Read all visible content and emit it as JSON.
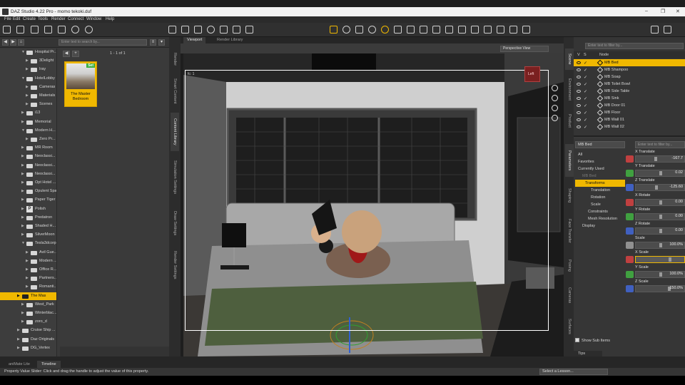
{
  "window": {
    "title": "DAZ Studio 4.22 Pro - momo tekoki.duf",
    "controls": [
      "–",
      "❐",
      "✕"
    ]
  },
  "menu": [
    "File",
    "Edit",
    "Create",
    "Tools",
    "Render",
    "Connect",
    "Window",
    "Help"
  ],
  "toolbar": {
    "icons": [
      "move-icon",
      "rotate-icon",
      "scale-icon",
      "universal-icon",
      "node-select-icon",
      "joint-editor-icon",
      "camera-icon",
      "light-icon",
      "render-icon"
    ]
  },
  "content_library": {
    "search_placeholder": "Enter text to search by...",
    "page": "1 - 1 of 1",
    "nav_prev": "◀",
    "nav_next": "+",
    "tree": [
      {
        "label": "Hospital Pr...",
        "depth": 2,
        "expanded": true
      },
      {
        "label": "3Delight",
        "depth": 3
      },
      {
        "label": "Iray",
        "depth": 3
      },
      {
        "label": "HotelLobby",
        "depth": 2,
        "expanded": true
      },
      {
        "label": "Cameras",
        "depth": 3
      },
      {
        "label": "Materials",
        "depth": 3
      },
      {
        "label": "Scenes",
        "depth": 3
      },
      {
        "label": "i13",
        "depth": 2
      },
      {
        "label": "Memorial",
        "depth": 2
      },
      {
        "label": "Modern H...",
        "depth": 2,
        "expanded": true
      },
      {
        "label": "Zero Pr...",
        "depth": 3
      },
      {
        "label": "MR Room",
        "depth": 2
      },
      {
        "label": "Neoclassi...",
        "depth": 2
      },
      {
        "label": "Neoclassi...",
        "depth": 2
      },
      {
        "label": "Neoclassi...",
        "depth": 2
      },
      {
        "label": "Opt Hotel ...",
        "depth": 2
      },
      {
        "label": "Opulent Spa",
        "depth": 2
      },
      {
        "label": "Paper Tiger",
        "depth": 2
      },
      {
        "label": "Polish",
        "depth": 2,
        "product": true
      },
      {
        "label": "Predatron",
        "depth": 2
      },
      {
        "label": "Shaded H...",
        "depth": 2
      },
      {
        "label": "SilverMoon",
        "depth": 2
      },
      {
        "label": "Tesla3dcorp",
        "depth": 2,
        "expanded": true
      },
      {
        "label": "Avil Gue...",
        "depth": 3
      },
      {
        "label": "Modern ...",
        "depth": 3
      },
      {
        "label": "Office R...",
        "depth": 3
      },
      {
        "label": "Partners...",
        "depth": 3
      },
      {
        "label": "Romanti...",
        "depth": 3
      },
      {
        "label": "The Mas",
        "depth": 1,
        "selected": true
      },
      {
        "label": "West_Park",
        "depth": 2
      },
      {
        "label": "Winterblac...",
        "depth": 2
      },
      {
        "label": "zoro_d",
        "depth": 2
      },
      {
        "label": "Cruise Ship ...",
        "depth": 1
      },
      {
        "label": "Daz Originals",
        "depth": 1
      },
      {
        "label": "DG_Vertex",
        "depth": 1
      }
    ],
    "thumbnail": {
      "label": "The Master Bedroom",
      "badge": "Set"
    }
  },
  "side_tabs_left": [
    "Render",
    "Smart Content",
    "Content Library",
    "Simulation Settings",
    "Draw Settings",
    "Render Settings"
  ],
  "viewport": {
    "tabs": [
      "Viewport",
      "Render Library"
    ],
    "perspective": "Perspective View",
    "label": "fc: 1",
    "navcube_label": "Left"
  },
  "scene": {
    "search_placeholder": "Enter text to filter by...",
    "columns": [
      "V",
      "S",
      "Node"
    ],
    "nodes": [
      {
        "label": "MB Bed",
        "selected": true
      },
      {
        "label": "MB Shampoo"
      },
      {
        "label": "MB Soap"
      },
      {
        "label": "MB Toilet Bowl"
      },
      {
        "label": "MB Side Table"
      },
      {
        "label": "MB Sink"
      },
      {
        "label": "MB Door 01"
      },
      {
        "label": "MB Floor"
      },
      {
        "label": "MB Wall 01"
      },
      {
        "label": "MB Wall 02"
      }
    ]
  },
  "side_tabs_right": [
    "Scene",
    "Environment",
    "Product",
    "Parameters",
    "Shaping",
    "Face Transfer",
    "Posing",
    "Cameras",
    "Surfaces"
  ],
  "parameters": {
    "selected_node": "MB Bed",
    "search_placeholder": "Enter text to filter by...",
    "filters": [
      {
        "label": "All"
      },
      {
        "label": "Favorites"
      },
      {
        "label": "Currently Used"
      },
      {
        "label": "MB Bed",
        "dim": true
      },
      {
        "label": "Transforms",
        "selected": true
      },
      {
        "label": "Translation"
      },
      {
        "label": "Rotation"
      },
      {
        "label": "Scale"
      },
      {
        "label": "Constraints"
      },
      {
        "label": "Mesh Resolution"
      },
      {
        "label": "Display"
      }
    ],
    "sliders": [
      {
        "label": "X Translate",
        "value": "-167.7",
        "color": "#c04040",
        "pos": 0.38
      },
      {
        "label": "Y Translate",
        "value": "0.02",
        "color": "#40a040",
        "pos": 0.5
      },
      {
        "label": "Z Translate",
        "value": "-125.60",
        "color": "#4060c0",
        "pos": 0.4
      },
      {
        "label": "X Rotate",
        "value": "0.00",
        "color": "#c04040",
        "pos": 0.5
      },
      {
        "label": "Y Rotate",
        "value": "0.00",
        "color": "#40a040",
        "pos": 0.5
      },
      {
        "label": "Z Rotate",
        "value": "0.00",
        "color": "#4060c0",
        "pos": 0.5
      },
      {
        "label": "Scale",
        "value": "100.0%",
        "color": "#909090",
        "pos": 0.5
      },
      {
        "label": "X Scale",
        "value": "",
        "color": "#c04040",
        "pos": 0.72,
        "active": true
      },
      {
        "label": "Y Scale",
        "value": "100.0%",
        "color": "#40a040",
        "pos": 0.5
      },
      {
        "label": "Z Scale",
        "value": "150.0%",
        "color": "#4060c0",
        "pos": 0.7
      }
    ],
    "show_sub_items": "Show Sub Items"
  },
  "tips_label": "Tips",
  "bottom_tabs": [
    "aniMate Lite",
    "Timeline"
  ],
  "status": {
    "message": "Property Value Slider: Click and drag the handle to adjust the value of this property.",
    "lesson": "Select a Lesson..."
  },
  "colors": {
    "accent": "#f0b800",
    "panel": "#3a3a3a",
    "dark": "#1d1d1d"
  }
}
